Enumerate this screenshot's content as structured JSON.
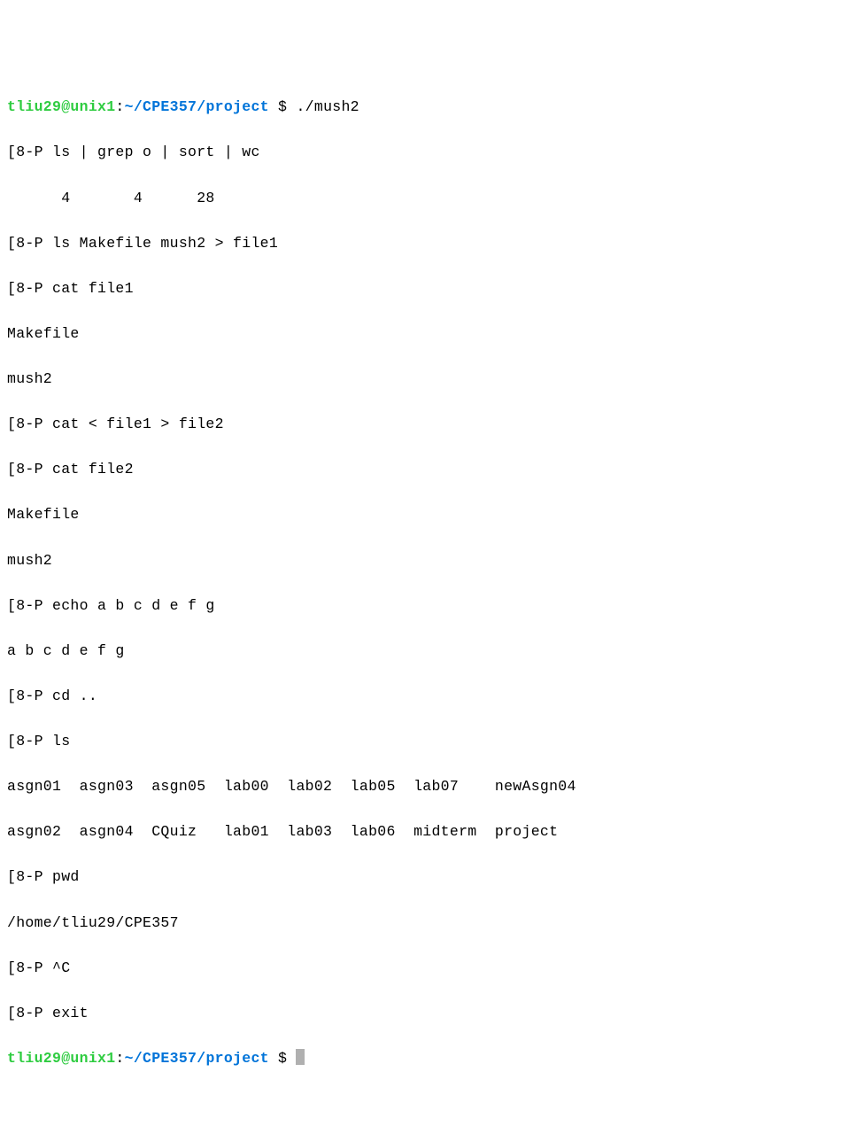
{
  "prompt1": {
    "user": "tliu29@unix1",
    "sep": ":",
    "path": "~/CPE357/project",
    "dollar": " $ ",
    "cmd": "./mush2"
  },
  "lines": {
    "l01": "[8-P ls | grep o | sort | wc",
    "l02": "      4       4      28",
    "l03": "[8-P ls Makefile mush2 > file1",
    "l04": "[8-P cat file1",
    "l05": "Makefile",
    "l06": "mush2",
    "l07": "[8-P cat < file1 > file2",
    "l08": "[8-P cat file2",
    "l09": "Makefile",
    "l10": "mush2",
    "l11": "[8-P echo a b c d e f g",
    "l12": "a b c d e f g",
    "l13": "[8-P cd ..",
    "l14": "[8-P ls",
    "l15": "asgn01  asgn03  asgn05  lab00  lab02  lab05  lab07    newAsgn04",
    "l16": "asgn02  asgn04  CQuiz   lab01  lab03  lab06  midterm  project",
    "l17": "[8-P pwd",
    "l18": "/home/tliu29/CPE357",
    "l19": "[8-P ^C",
    "l20": "[8-P exit"
  },
  "prompt2": {
    "user": "tliu29@unix1",
    "sep": ":",
    "path": "~/CPE357/project",
    "dollar": " $ "
  }
}
